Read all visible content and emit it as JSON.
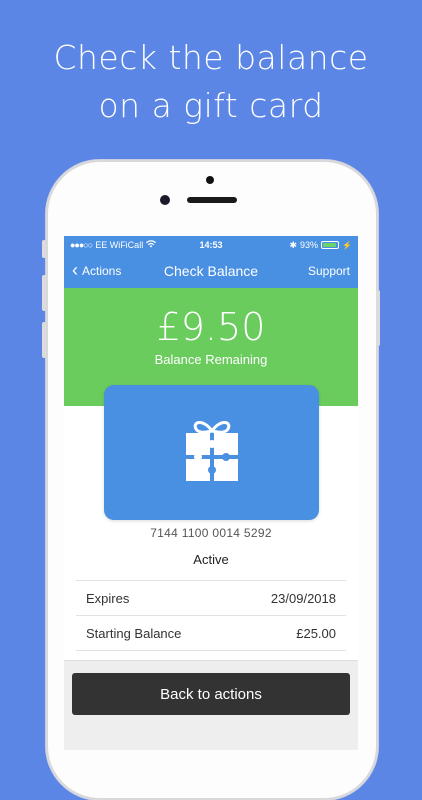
{
  "headline": {
    "line1": "Check the balance",
    "line2": "on a gift card"
  },
  "status_bar": {
    "carrier": "EE WiFiCall",
    "time": "14:53",
    "battery": "93%",
    "battery_level": 0.93
  },
  "nav": {
    "back_label": "Actions",
    "title": "Check Balance",
    "support_label": "Support"
  },
  "balance": {
    "amount": "£9.50",
    "label": "Balance Remaining"
  },
  "card": {
    "icon": "gift-puzzle-icon",
    "number": "7144 1100 0014 5292",
    "status": "Active"
  },
  "details": [
    {
      "label": "Expires",
      "value": "23/09/2018"
    },
    {
      "label": "Starting Balance",
      "value": "£25.00"
    }
  ],
  "actions": {
    "back_button": "Back to actions"
  },
  "colors": {
    "background": "#5b86e5",
    "nav_blue": "#4a90e2",
    "balance_green": "#6bcc5e",
    "card_blue": "#4a90e2",
    "button_dark": "#333333"
  }
}
